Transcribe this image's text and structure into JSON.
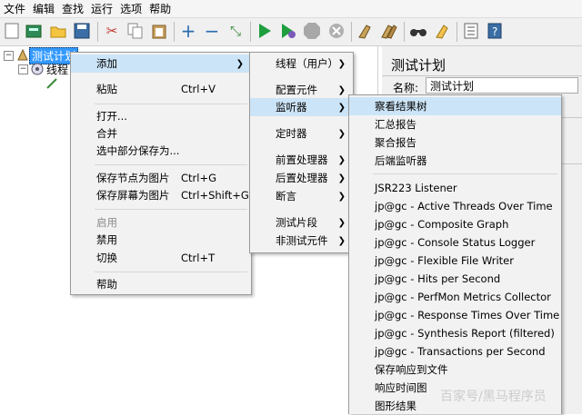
{
  "menubar": [
    "文件",
    "编辑",
    "查找",
    "运行",
    "选项",
    "帮助"
  ],
  "toolbar_icons": [
    "new-icon",
    "templates-icon",
    "open-icon",
    "save-icon",
    "cut-icon",
    "copy-icon",
    "paste-icon",
    "expand-icon",
    "collapse-icon",
    "toggle-icon",
    "start-icon",
    "start-no-pause-icon",
    "stop-icon",
    "shutdown-icon",
    "clear-icon",
    "clear-all-icon",
    "search-icon",
    "reset-search-icon",
    "function-helper-icon",
    "help-icon"
  ],
  "tree": {
    "root_label": "测试计划",
    "child_label": "线程"
  },
  "right_panel": {
    "title": "测试计划",
    "name_label": "名称:",
    "name_value": "测试计划"
  },
  "context_menu": {
    "add": "添加",
    "paste": "粘贴",
    "paste_shortcut": "Ctrl+V",
    "open": "打开...",
    "merge": "合并",
    "save_selection": "选中部分保存为...",
    "save_node_image": "保存节点为图片",
    "save_node_image_shortcut": "Ctrl+G",
    "save_screen_image": "保存屏幕为图片",
    "save_screen_image_shortcut": "Ctrl+Shift+G",
    "enable": "启用",
    "disable": "禁用",
    "toggle": "切换",
    "toggle_shortcut": "Ctrl+T",
    "help": "帮助"
  },
  "add_submenu": {
    "threads": "线程（用户）",
    "config": "配置元件",
    "listener": "监听器",
    "timer": "定时器",
    "pre": "前置处理器",
    "post": "后置处理器",
    "assertion": "断言",
    "fragment": "测试片段",
    "non_test": "非测试元件"
  },
  "listener_submenu": [
    "察看结果树",
    "汇总报告",
    "聚合报告",
    "后端监听器",
    "JSR223 Listener",
    "jp@gc - Active Threads Over Time",
    "jp@gc - Composite Graph",
    "jp@gc - Console Status Logger",
    "jp@gc - Flexible File Writer",
    "jp@gc - Hits per Second",
    "jp@gc - PerfMon Metrics Collector",
    "jp@gc - Response Times Over Time",
    "jp@gc - Synthesis Report (filtered)",
    "jp@gc - Transactions per Second",
    "保存响应到文件",
    "响应时间图",
    "图形结果"
  ],
  "watermark": "百家号/黑马程序员"
}
